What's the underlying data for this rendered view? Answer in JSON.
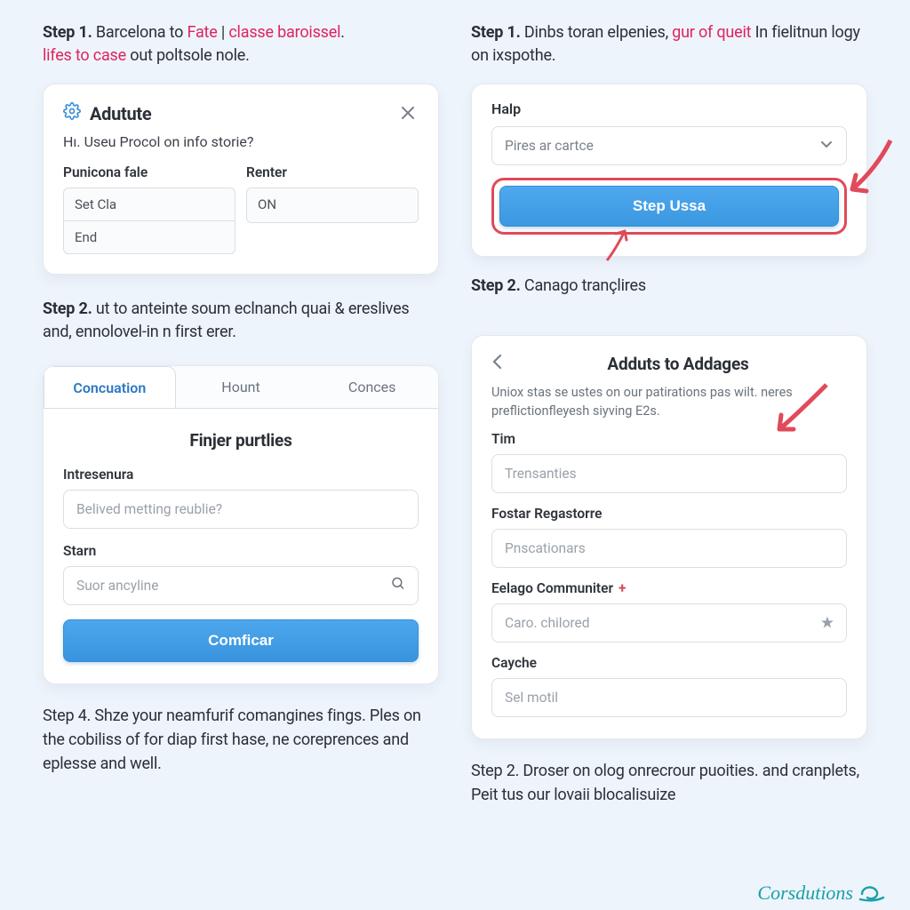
{
  "left": {
    "step1": {
      "label": "Step 1.",
      "plain1": "Barcelona to ",
      "redA": "Fate",
      "plain2": " | ",
      "redB": "classe baroissel",
      "plain3": ". ",
      "redC": "lifes to case",
      "plain4": " out poltsole nole."
    },
    "adutute": {
      "title": "Adutute",
      "subtitle": "Hı. Useu Procol on info storie?",
      "col1_label": "Punicona fale",
      "col1_row1": "Set Cla",
      "col1_row2": "End",
      "col2_label": "Renter",
      "col2_value": "ON"
    },
    "step2": {
      "label": "Step 2.",
      "text": "ut to anteinte soum eclnanch quai & ereslives and, ennolovel-in n first erer."
    },
    "tabs": [
      "Concuation",
      "Hount",
      "Conces"
    ],
    "form": {
      "section_title": "Finjer purtlies",
      "f1_label": "Intresenura",
      "f1_placeholder": "Belived metting reublie?",
      "f2_label": "Starn",
      "f2_placeholder": "Suor ancyline",
      "submit": "Comficar"
    },
    "step4": {
      "label": "Step 4.",
      "plain1": "Shze your neamfurif comangines fings. Ples on the cobiliss",
      "red": "of for diap first hase",
      "plain2": ", ne coreprences and eplesse and well."
    }
  },
  "right": {
    "step1": {
      "label": "Step 1.",
      "plain1": "Dinbs toran elpenies, ",
      "red": "gur of queit",
      "plain2": " In fielitnun logy on ixspothe."
    },
    "help": {
      "label": "Halp",
      "select_placeholder": "Pires ar cartce",
      "cta": "Step Ussa"
    },
    "step2a": {
      "label": "Step 2.",
      "text": "Canago trançlires"
    },
    "adduts": {
      "title": "Adduts to Addages",
      "subtitle": "Uniox stas se ustes on our patirations pas wilt. neres preflictionfleyesh siyving E2s.",
      "f1_label": "Tim",
      "f1_placeholder": "Trensanties",
      "f2_label": "Fostar Regastorre",
      "f2_placeholder": "Pnscationars",
      "f3_label": "Eelago Communiter",
      "f3_placeholder": "Caro. chilored",
      "f4_label": "Cayche",
      "f4_placeholder": "Sel motil"
    },
    "step2b": {
      "label": "Step 2.",
      "text": "Droser on olog onrecrour puoities. and cranplets, Peit tus our lovaii blocalisuize"
    }
  },
  "brand": "Corsdutions"
}
